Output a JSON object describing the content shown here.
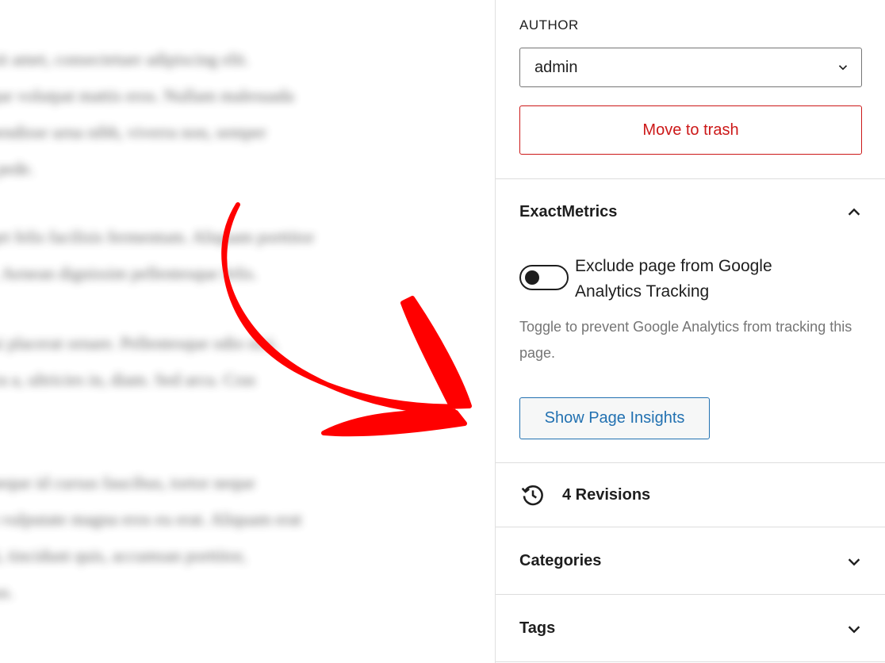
{
  "editor": {
    "paragraphs": [
      "r sit amet, consectetuer adipiscing elit.\nsque volutpat mattis eros. Nullam malesuada\nspendisse urna nibh, viverra non, semper\ns, pede.",
      "eget felis facilisis fermentum. Aliquam porttitor\nci. Aenean dignissim pellentesque felis.",
      "dui placerat ornare. Pellentesque odio nisi,\netra a, ultricies in, diam. Sed arcu. Cras",
      ", neque id cursus faucibus, tortor neque\neu vulputate magna eros eu erat. Aliquam erat\nmi, tincidunt quis, accumsan porttitor,\netus."
    ],
    "arrow_color": "#ff0000"
  },
  "sidebar": {
    "author": {
      "label": "AUTHOR",
      "selected": "admin"
    },
    "trash_label": "Move to trash",
    "exactmetrics": {
      "title": "ExactMetrics",
      "toggle_label": "Exclude page from Google Analytics Tracking",
      "toggle_on": false,
      "help": "Toggle to prevent Google Analytics from tracking this page.",
      "insights_label": "Show Page Insights"
    },
    "revisions_label": "4 Revisions",
    "categories_label": "Categories",
    "tags_label": "Tags"
  },
  "colors": {
    "danger": "#cc1818",
    "link": "#2271b1",
    "muted": "#757575"
  }
}
